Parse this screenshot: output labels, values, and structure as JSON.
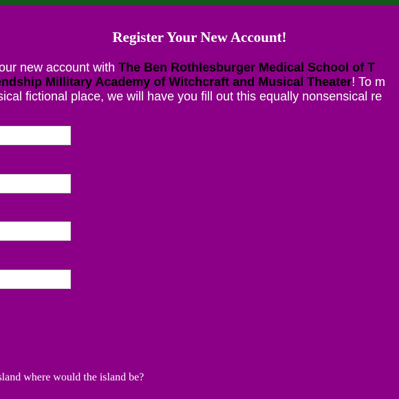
{
  "header": {
    "accent_bar_color": "#0f5a17",
    "background_color": "#8b0087"
  },
  "form": {
    "title": "Register Your New Account!",
    "intro": {
      "line1_pre": "your new account with ",
      "line1_hl": "The Ben Rothlesburger Medical School of T",
      "line2_hl": "endship Millitary Academy of Witchcraft and Musical Theater",
      "line2_post": "! To m",
      "line3": "sical fictional place, we will have you fill out this equally nonsensical re"
    },
    "fields": [
      {
        "value": "",
        "placeholder": ""
      },
      {
        "value": "",
        "placeholder": ""
      },
      {
        "value": "",
        "placeholder": ""
      },
      {
        "value": "",
        "placeholder": ""
      }
    ],
    "question": "island where would the island be?"
  }
}
